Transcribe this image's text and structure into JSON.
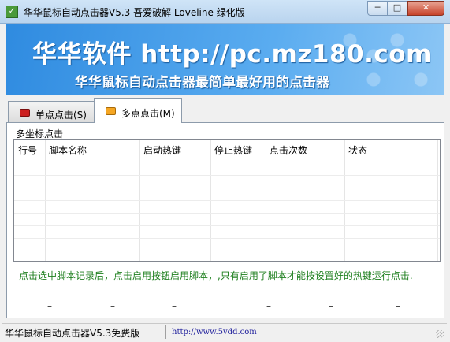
{
  "window": {
    "title": "华华鼠标自动点击器V5.3  吾爱破解 Loveline 绿化版",
    "minimize_label": "─",
    "maximize_label": "□",
    "close_label": "✕"
  },
  "banner": {
    "headline": "华华软件 http://pc.mz180.com",
    "tagline": "华华鼠标自动点击器最简单最好用的点击器"
  },
  "tabs": [
    {
      "label": "单点点击(S)",
      "color": "#cc1f1f",
      "active": false
    },
    {
      "label": "多点点击(M)",
      "color": "#f5a623",
      "active": true
    }
  ],
  "panel": {
    "group_label": "多坐标点击",
    "columns": [
      "行号",
      "脚本名称",
      "启动热键",
      "停止热键",
      "点击次数",
      "状态"
    ],
    "rows": [],
    "hint": "点击选中脚本记录后，点击启用按钮启用脚本，,只有启用了脚本才能按设置好的热键运行点击.",
    "placeholders": [
      "–",
      "–",
      "–",
      "–",
      "–",
      "–",
      "–"
    ]
  },
  "statusbar": {
    "product": "华华鼠标自动点击器V5.3免费版",
    "url": "http://www.5vdd.com"
  },
  "colors": {
    "banner": "#2f8be0",
    "hint_text": "#1e7f1e",
    "close_button": "#c7432b"
  }
}
